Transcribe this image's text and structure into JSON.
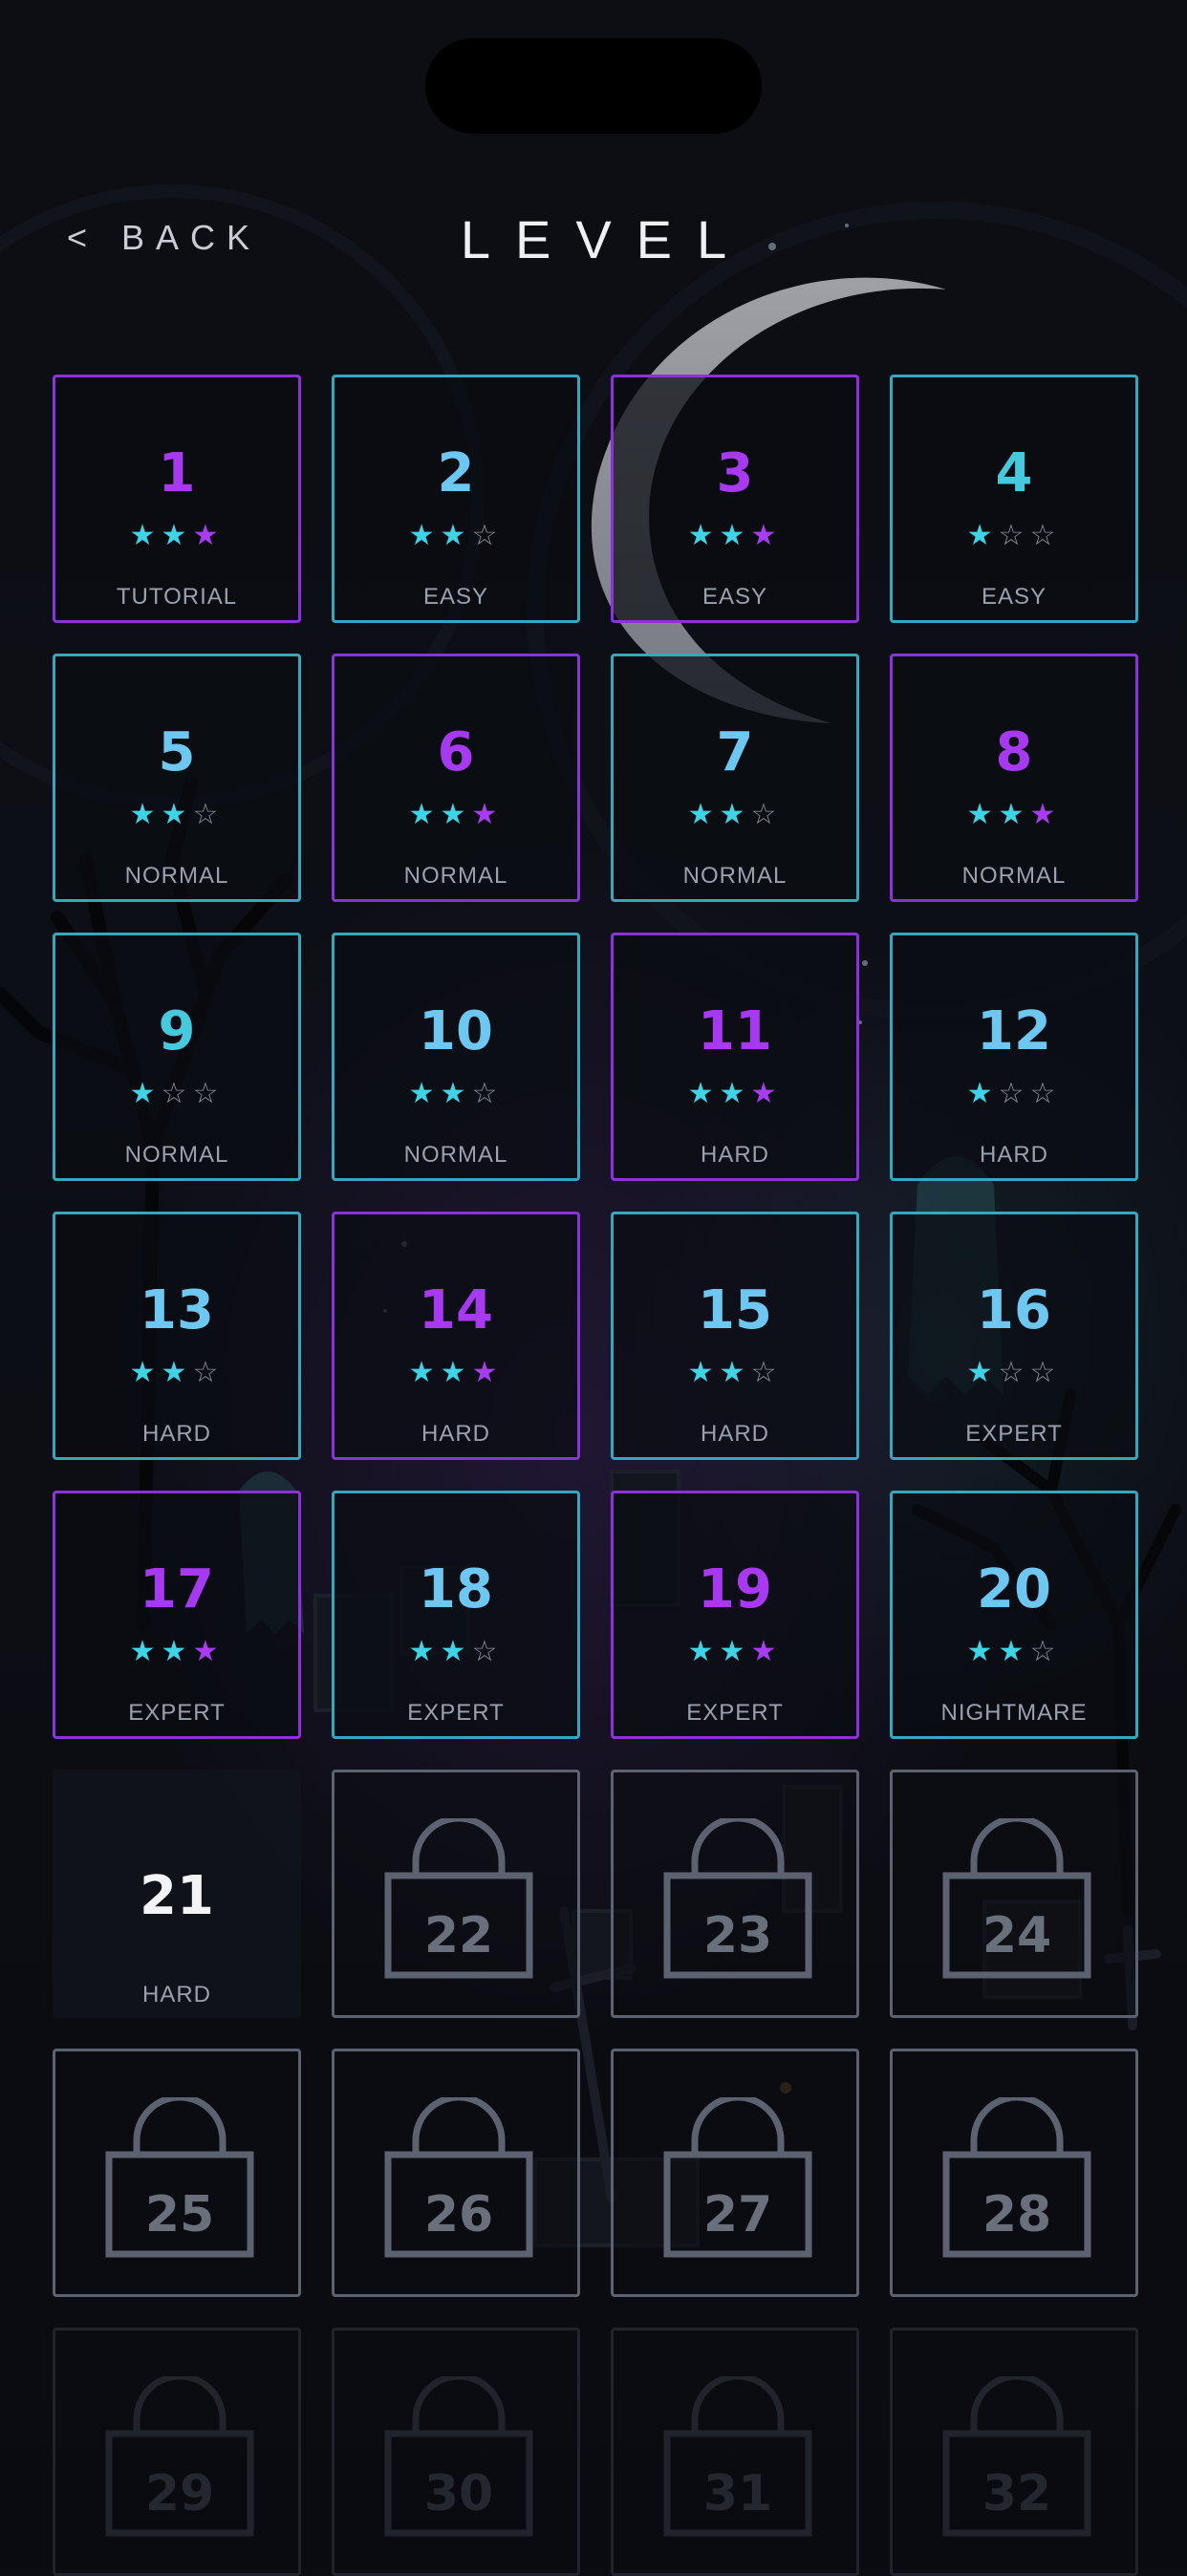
{
  "header": {
    "back_label": "BACK",
    "back_icon": "chevron-left-icon",
    "title": "LEVEL"
  },
  "levels": [
    {
      "n": "1",
      "stars": 3,
      "label": "TUTORIAL",
      "style": "purple"
    },
    {
      "n": "2",
      "stars": 2,
      "label": "EASY",
      "style": "cyan"
    },
    {
      "n": "3",
      "stars": 3,
      "label": "EASY",
      "style": "purple"
    },
    {
      "n": "4",
      "stars": 1,
      "label": "EASY",
      "style": "cyan"
    },
    {
      "n": "5",
      "stars": 2,
      "label": "NORMAL",
      "style": "cyan"
    },
    {
      "n": "6",
      "stars": 3,
      "label": "NORMAL",
      "style": "purple"
    },
    {
      "n": "7",
      "stars": 2,
      "label": "NORMAL",
      "style": "cyan"
    },
    {
      "n": "8",
      "stars": 3,
      "label": "NORMAL",
      "style": "purple"
    },
    {
      "n": "9",
      "stars": 1,
      "label": "NORMAL",
      "style": "cyan"
    },
    {
      "n": "10",
      "stars": 2,
      "label": "NORMAL",
      "style": "cyan"
    },
    {
      "n": "11",
      "stars": 3,
      "label": "HARD",
      "style": "purple"
    },
    {
      "n": "12",
      "stars": 1,
      "label": "HARD",
      "style": "cyan"
    },
    {
      "n": "13",
      "stars": 2,
      "label": "HARD",
      "style": "cyan"
    },
    {
      "n": "14",
      "stars": 3,
      "label": "HARD",
      "style": "purple"
    },
    {
      "n": "15",
      "stars": 2,
      "label": "HARD",
      "style": "cyan"
    },
    {
      "n": "16",
      "stars": 1,
      "label": "EXPERT",
      "style": "cyan"
    },
    {
      "n": "17",
      "stars": 3,
      "label": "EXPERT",
      "style": "purple"
    },
    {
      "n": "18",
      "stars": 2,
      "label": "EXPERT",
      "style": "cyan"
    },
    {
      "n": "19",
      "stars": 3,
      "label": "EXPERT",
      "style": "purple"
    },
    {
      "n": "20",
      "stars": 2,
      "label": "NIGHTMARE",
      "style": "cyan"
    },
    {
      "n": "21",
      "stars": 0,
      "label": "HARD",
      "style": "current"
    },
    {
      "n": "22",
      "locked": true
    },
    {
      "n": "23",
      "locked": true
    },
    {
      "n": "24",
      "locked": true
    },
    {
      "n": "25",
      "locked": true
    },
    {
      "n": "26",
      "locked": true
    },
    {
      "n": "27",
      "locked": true
    },
    {
      "n": "28",
      "locked": true
    },
    {
      "n": "29",
      "locked": true,
      "faded": true
    },
    {
      "n": "30",
      "locked": true,
      "faded": true
    },
    {
      "n": "31",
      "locked": true,
      "faded": true
    },
    {
      "n": "32",
      "locked": true,
      "faded": true
    }
  ],
  "colors": {
    "cyan_border": "#37a7bd",
    "purple_border": "#8b32d9",
    "star_on": "#3fd3e6",
    "star_max": "#a83cf2",
    "locked": "#5d6270"
  },
  "icons": {
    "star": "star-icon",
    "lock": "padlock-icon",
    "moon": "crescent-moon"
  }
}
